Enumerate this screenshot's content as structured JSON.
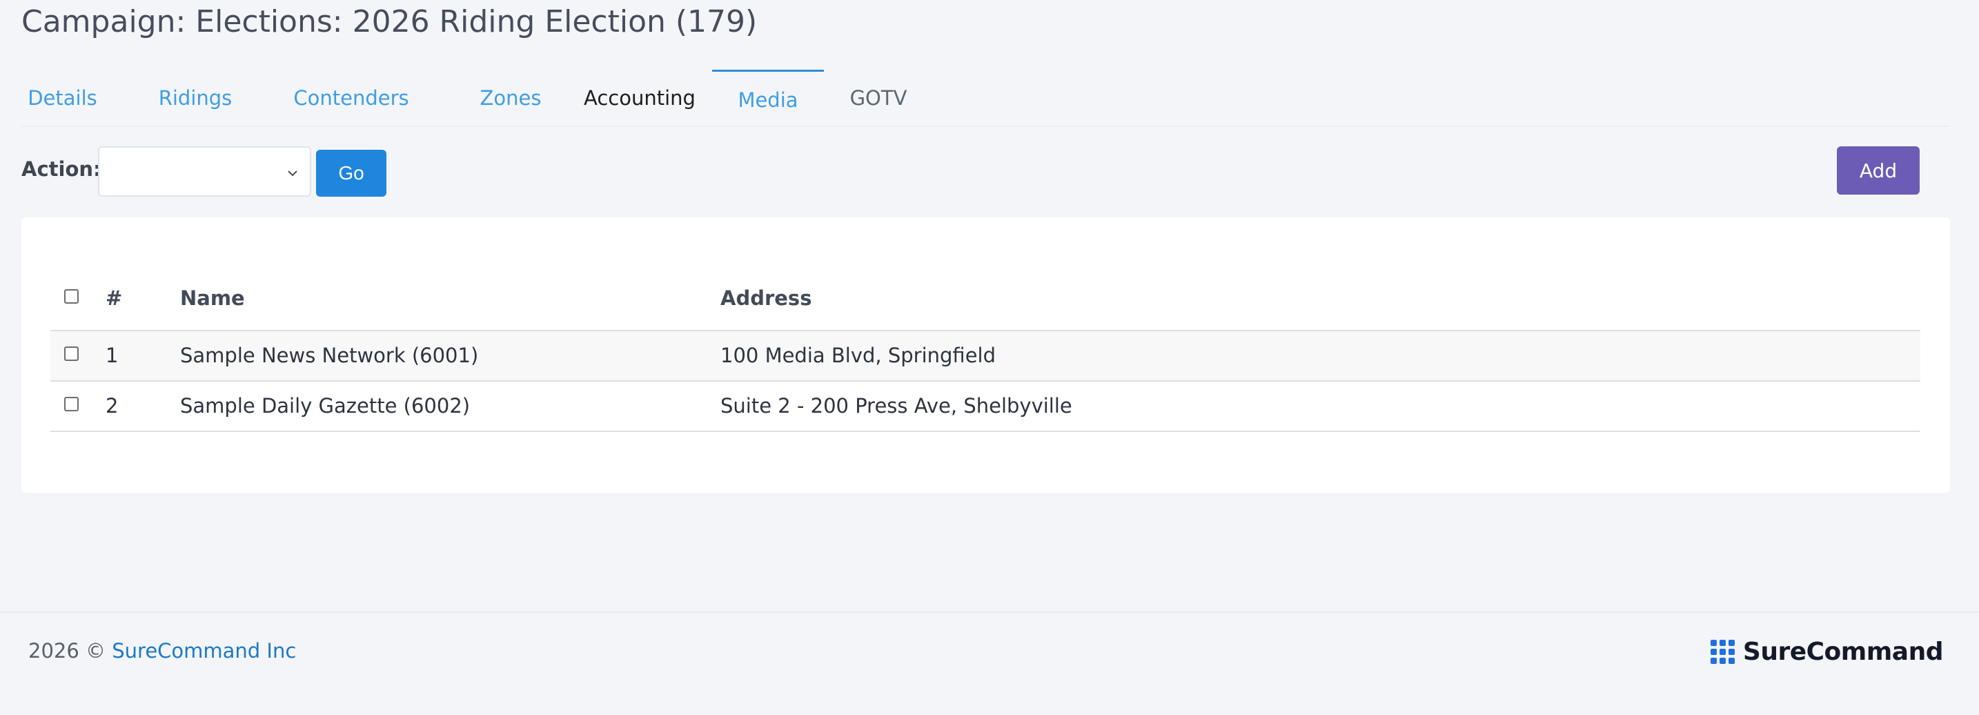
{
  "page": {
    "title": "Campaign: Elections: 2026 Riding Election (179)"
  },
  "tabs": [
    {
      "label": "Details"
    },
    {
      "label": "Ridings"
    },
    {
      "label": "Contenders"
    },
    {
      "label": "Zones"
    },
    {
      "label": "Accounting"
    },
    {
      "label": "Media",
      "active": true
    },
    {
      "label": "GOTV"
    }
  ],
  "action_bar": {
    "label": "Action:",
    "selected": "",
    "go_label": "Go",
    "add_label": "Add"
  },
  "table": {
    "columns": [
      "#",
      "Name",
      "Address"
    ],
    "rows": [
      {
        "num": "1",
        "name": "Sample News Network (6001)",
        "address": "100 Media Blvd, Springfield"
      },
      {
        "num": "2",
        "name": "Sample Daily Gazette (6002)",
        "address": "Suite 2 - 200 Press Ave, Shelbyville"
      }
    ]
  },
  "footer": {
    "copyright": "2026 ©",
    "company_link": "SureCommand Inc",
    "brand_name": "SureCommand"
  },
  "colors": {
    "link": "#1a79c8",
    "go_button": "#1f86de",
    "add_button": "#6d5cb6",
    "brand_icon": "#1f6fe0"
  },
  "icons": {
    "select_caret": "chevron-down-icon",
    "brand_logo": "grid-dots-icon"
  }
}
